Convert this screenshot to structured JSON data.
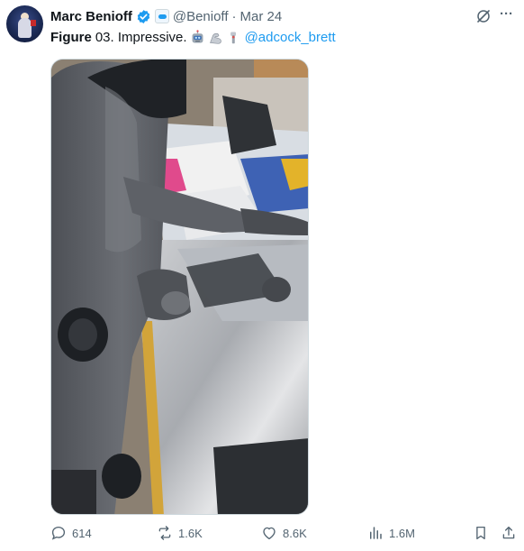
{
  "tweet": {
    "author_name": "Marc Benioff",
    "handle": "@Benioff",
    "separator": "·",
    "date": "Mar 24",
    "text_bold": "Figure",
    "text_rest": "03. Impressive.",
    "mention": "@adcock_brett",
    "emojis": [
      "robot-face-icon",
      "flexed-arm-icon",
      "mechanical-arm-icon"
    ]
  },
  "actions": {
    "replies": "614",
    "reposts": "1.6K",
    "likes": "8.6K",
    "views": "1.6M"
  },
  "colors": {
    "accent": "#1d9bf0",
    "muted": "#536471",
    "text": "#0f1419"
  }
}
